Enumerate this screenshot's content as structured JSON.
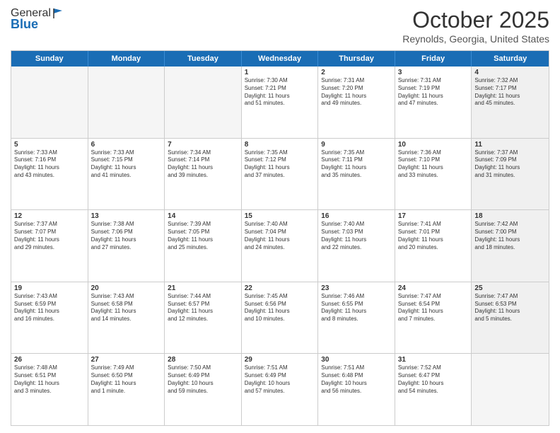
{
  "header": {
    "logo_general": "General",
    "logo_blue": "Blue",
    "month": "October 2025",
    "location": "Reynolds, Georgia, United States"
  },
  "days_of_week": [
    "Sunday",
    "Monday",
    "Tuesday",
    "Wednesday",
    "Thursday",
    "Friday",
    "Saturday"
  ],
  "rows": [
    [
      {
        "day": "",
        "text": "",
        "empty": true
      },
      {
        "day": "",
        "text": "",
        "empty": true
      },
      {
        "day": "",
        "text": "",
        "empty": true
      },
      {
        "day": "1",
        "text": "Sunrise: 7:30 AM\nSunset: 7:21 PM\nDaylight: 11 hours\nand 51 minutes."
      },
      {
        "day": "2",
        "text": "Sunrise: 7:31 AM\nSunset: 7:20 PM\nDaylight: 11 hours\nand 49 minutes."
      },
      {
        "day": "3",
        "text": "Sunrise: 7:31 AM\nSunset: 7:19 PM\nDaylight: 11 hours\nand 47 minutes."
      },
      {
        "day": "4",
        "text": "Sunrise: 7:32 AM\nSunset: 7:17 PM\nDaylight: 11 hours\nand 45 minutes.",
        "shaded": true
      }
    ],
    [
      {
        "day": "5",
        "text": "Sunrise: 7:33 AM\nSunset: 7:16 PM\nDaylight: 11 hours\nand 43 minutes."
      },
      {
        "day": "6",
        "text": "Sunrise: 7:33 AM\nSunset: 7:15 PM\nDaylight: 11 hours\nand 41 minutes."
      },
      {
        "day": "7",
        "text": "Sunrise: 7:34 AM\nSunset: 7:14 PM\nDaylight: 11 hours\nand 39 minutes."
      },
      {
        "day": "8",
        "text": "Sunrise: 7:35 AM\nSunset: 7:12 PM\nDaylight: 11 hours\nand 37 minutes."
      },
      {
        "day": "9",
        "text": "Sunrise: 7:35 AM\nSunset: 7:11 PM\nDaylight: 11 hours\nand 35 minutes."
      },
      {
        "day": "10",
        "text": "Sunrise: 7:36 AM\nSunset: 7:10 PM\nDaylight: 11 hours\nand 33 minutes."
      },
      {
        "day": "11",
        "text": "Sunrise: 7:37 AM\nSunset: 7:09 PM\nDaylight: 11 hours\nand 31 minutes.",
        "shaded": true
      }
    ],
    [
      {
        "day": "12",
        "text": "Sunrise: 7:37 AM\nSunset: 7:07 PM\nDaylight: 11 hours\nand 29 minutes."
      },
      {
        "day": "13",
        "text": "Sunrise: 7:38 AM\nSunset: 7:06 PM\nDaylight: 11 hours\nand 27 minutes."
      },
      {
        "day": "14",
        "text": "Sunrise: 7:39 AM\nSunset: 7:05 PM\nDaylight: 11 hours\nand 25 minutes."
      },
      {
        "day": "15",
        "text": "Sunrise: 7:40 AM\nSunset: 7:04 PM\nDaylight: 11 hours\nand 24 minutes."
      },
      {
        "day": "16",
        "text": "Sunrise: 7:40 AM\nSunset: 7:03 PM\nDaylight: 11 hours\nand 22 minutes."
      },
      {
        "day": "17",
        "text": "Sunrise: 7:41 AM\nSunset: 7:01 PM\nDaylight: 11 hours\nand 20 minutes."
      },
      {
        "day": "18",
        "text": "Sunrise: 7:42 AM\nSunset: 7:00 PM\nDaylight: 11 hours\nand 18 minutes.",
        "shaded": true
      }
    ],
    [
      {
        "day": "19",
        "text": "Sunrise: 7:43 AM\nSunset: 6:59 PM\nDaylight: 11 hours\nand 16 minutes."
      },
      {
        "day": "20",
        "text": "Sunrise: 7:43 AM\nSunset: 6:58 PM\nDaylight: 11 hours\nand 14 minutes."
      },
      {
        "day": "21",
        "text": "Sunrise: 7:44 AM\nSunset: 6:57 PM\nDaylight: 11 hours\nand 12 minutes."
      },
      {
        "day": "22",
        "text": "Sunrise: 7:45 AM\nSunset: 6:56 PM\nDaylight: 11 hours\nand 10 minutes."
      },
      {
        "day": "23",
        "text": "Sunrise: 7:46 AM\nSunset: 6:55 PM\nDaylight: 11 hours\nand 8 minutes."
      },
      {
        "day": "24",
        "text": "Sunrise: 7:47 AM\nSunset: 6:54 PM\nDaylight: 11 hours\nand 7 minutes."
      },
      {
        "day": "25",
        "text": "Sunrise: 7:47 AM\nSunset: 6:53 PM\nDaylight: 11 hours\nand 5 minutes.",
        "shaded": true
      }
    ],
    [
      {
        "day": "26",
        "text": "Sunrise: 7:48 AM\nSunset: 6:51 PM\nDaylight: 11 hours\nand 3 minutes."
      },
      {
        "day": "27",
        "text": "Sunrise: 7:49 AM\nSunset: 6:50 PM\nDaylight: 11 hours\nand 1 minute."
      },
      {
        "day": "28",
        "text": "Sunrise: 7:50 AM\nSunset: 6:49 PM\nDaylight: 10 hours\nand 59 minutes."
      },
      {
        "day": "29",
        "text": "Sunrise: 7:51 AM\nSunset: 6:49 PM\nDaylight: 10 hours\nand 57 minutes."
      },
      {
        "day": "30",
        "text": "Sunrise: 7:51 AM\nSunset: 6:48 PM\nDaylight: 10 hours\nand 56 minutes."
      },
      {
        "day": "31",
        "text": "Sunrise: 7:52 AM\nSunset: 6:47 PM\nDaylight: 10 hours\nand 54 minutes."
      },
      {
        "day": "",
        "text": "",
        "empty": true,
        "shaded": true
      }
    ]
  ]
}
